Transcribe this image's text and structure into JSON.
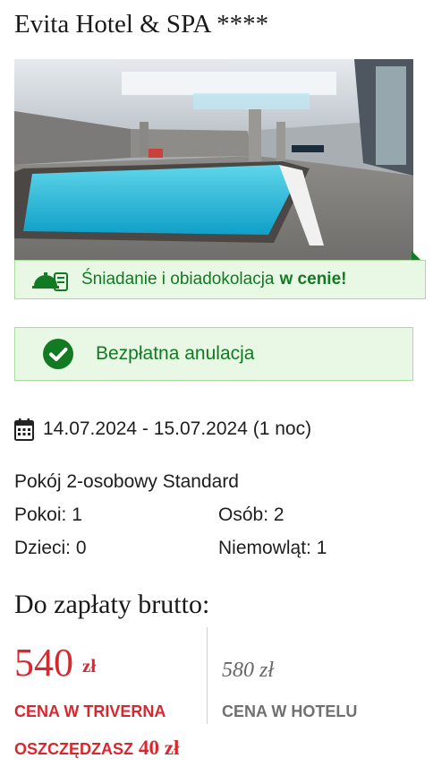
{
  "hotel": {
    "name": "Evita Hotel & SPA ****"
  },
  "photo": {
    "subject": "indoor-swimming-pool"
  },
  "promo": {
    "text": "Śniadanie i obiadokolacja",
    "highlight": "w cenie!",
    "icon": "food-tray-icon"
  },
  "cancellation": {
    "text": "Bezpłatna anulacja",
    "icon": "check-circle-icon"
  },
  "stay": {
    "dates": "14.07.2024 - 15.07.2024 (1 noc)",
    "icon": "calendar-icon"
  },
  "room": {
    "type": "Pokój 2-osobowy Standard",
    "rooms": "Pokoi: 1",
    "guests": "Osób: 2",
    "children": "Dzieci: 0",
    "infants": "Niemowląt: 1"
  },
  "payment": {
    "title": "Do zapłaty brutto:",
    "price": "540",
    "currency": "zł",
    "price_label": "CENA W TRIVERNA",
    "hotel_price": "580 zł",
    "hotel_label": "CENA W HOTELU",
    "savings_label": "OSZCZĘDZASZ",
    "savings_amount": "40 zł"
  },
  "colors": {
    "accent_red": "#d8282f",
    "green_text": "#117a22",
    "green_bg": "#e9f8e5"
  }
}
